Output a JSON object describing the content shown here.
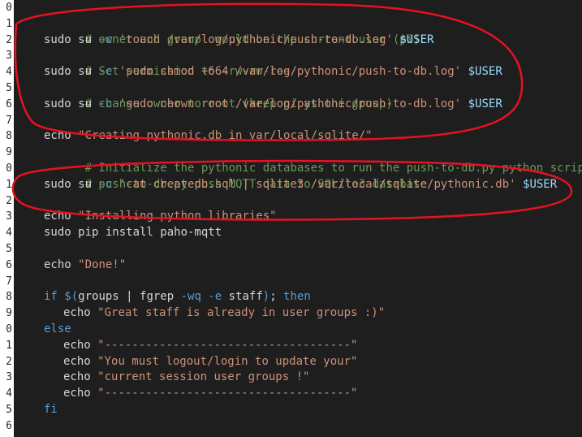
{
  "theme": {
    "background": "#1e1e1e",
    "gutter_background": "#ffffff",
    "comment_color": "#6a9955",
    "string_color": "#ce9178",
    "variable_color": "#9cdcfe",
    "keyword_color": "#569cd6",
    "text_color": "#d4d4d4",
    "annotation_color": "#e81123"
  },
  "gutter": {
    "line_numbers": [
      "0",
      "1",
      "2",
      "3",
      "4",
      "5",
      "6",
      "7",
      "8",
      "9",
      "0",
      "1",
      "2",
      "3",
      "4",
      "5",
      "6",
      "7",
      "8",
      "9",
      "0",
      "1",
      "2",
      "3",
      "4",
      "5",
      "6"
    ]
  },
  "code": {
    "l1": {
      "comment": "# owner and group  would be the current user (pi)"
    },
    "l2": {
      "cmd": "sudo su ",
      "flag": "-c",
      "str": " 'touch /var/log/pythonic/push-to-db.log'",
      "var": " $USER"
    },
    "l3": {
      "comment": "# Set permission to -rw-rw-r--"
    },
    "l4": {
      "cmd": "sudo su ",
      "flag": "-c",
      "str": " 'sudo chmod +664 /var/log/pythonic/push-to-db.log'",
      "var": " $USER"
    },
    "l5": {
      "comment": "# change owner to root (keep pi as the group)"
    },
    "l6": {
      "cmd": "sudo su ",
      "flag": "-c",
      "str": " 'sudo chown root /var/log/pythonic/push-to-db.log'",
      "var": " $USER"
    },
    "l8": {
      "cmd": "echo ",
      "str": "\"Creating pythonic.db in var/local/sqlite/\""
    },
    "l9": {
      "comment": "# Initialize the pythonic databases to run the push-to-db.py python script."
    },
    "l10": {
      "comment": "# push-to-db.py push MQTT data to SQLite3 database"
    },
    "l11": {
      "cmd": "sudo su ",
      "flag": "-c",
      "str": " 'cat createdb.sql | sqlite3 /var/local/sqlite/pythonic.db'",
      "var": " $USER"
    },
    "l13": {
      "cmd": "echo ",
      "str": "\"Installing python libraries\""
    },
    "l14": {
      "cmd": "sudo pip install paho-mqtt"
    },
    "l16": {
      "cmd": "echo ",
      "str": "\"Done!\""
    },
    "l18": {
      "kw": "if ",
      "sub_open": "$(",
      "cmd": "groups | fgrep ",
      "flag": "-wq -e",
      "cmd2": " staff",
      "sub_close": ")",
      "semi": "; ",
      "kw2": "then"
    },
    "l19": {
      "cmd": "echo ",
      "str": "\"Great staff is already in user groups :)\""
    },
    "l20": {
      "kw": "else"
    },
    "l21": {
      "cmd": "echo ",
      "str": "\"------------------------------------\""
    },
    "l22": {
      "cmd": "echo ",
      "str": "\"You must logout/login to update your\""
    },
    "l23": {
      "cmd": "echo ",
      "str": "\"current session user groups !\""
    },
    "l24": {
      "cmd": "echo ",
      "str": "\"------------------------------------\""
    },
    "l25": {
      "kw": "fi"
    }
  }
}
